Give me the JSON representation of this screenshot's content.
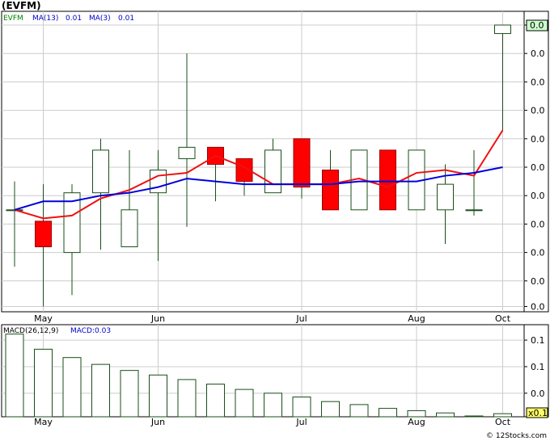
{
  "header": {
    "title": "(EVFM)"
  },
  "footer": {
    "copyright": "© 12Stocks.com"
  },
  "chart_data": [
    {
      "type": "candlestick",
      "legend": [
        "EVFM",
        "MA(13)",
        "0.01",
        "MA(3)",
        "0.01"
      ],
      "legend_colors": [
        "#008000",
        "#0000cc",
        "#0000cc",
        "#0000cc",
        "#0000cc"
      ],
      "ylim": [
        0,
        10
      ],
      "y_tick_values": [
        0.1,
        1.0,
        2.0,
        3.0,
        4.0,
        5.0,
        6.0,
        7.0,
        8.0,
        9.0,
        10.0
      ],
      "y_tick_labels": [
        "0.0",
        "0.0",
        "0.0",
        "0.0",
        "0.0",
        "0.0",
        "0.0",
        "0.0",
        "0.0",
        "0.0",
        "0.0"
      ],
      "last_value_label": "0.0",
      "x_labels": [
        {
          "label": "May",
          "index": 1
        },
        {
          "label": "Jun",
          "index": 5
        },
        {
          "label": "Jul",
          "index": 10
        },
        {
          "label": "Aug",
          "index": 14
        },
        {
          "label": "Oct",
          "index": 17
        }
      ],
      "candles": [
        {
          "o": 3.5,
          "h": 4.5,
          "l": 1.5,
          "c": 3.5
        },
        {
          "o": 3.1,
          "h": 4.4,
          "l": 0.1,
          "c": 2.2
        },
        {
          "o": 2.0,
          "h": 4.4,
          "l": 0.5,
          "c": 4.1
        },
        {
          "o": 4.1,
          "h": 6.0,
          "l": 2.1,
          "c": 5.6
        },
        {
          "o": 2.2,
          "h": 5.6,
          "l": 2.2,
          "c": 3.5
        },
        {
          "o": 4.1,
          "h": 5.6,
          "l": 1.7,
          "c": 4.9
        },
        {
          "o": 5.3,
          "h": 9.0,
          "l": 2.9,
          "c": 5.7
        },
        {
          "o": 5.7,
          "h": 5.7,
          "l": 3.8,
          "c": 5.1
        },
        {
          "o": 5.3,
          "h": 5.3,
          "l": 4.0,
          "c": 4.5
        },
        {
          "o": 4.1,
          "h": 6.0,
          "l": 4.1,
          "c": 5.6
        },
        {
          "o": 6.0,
          "h": 6.0,
          "l": 3.9,
          "c": 4.3
        },
        {
          "o": 4.9,
          "h": 5.6,
          "l": 3.5,
          "c": 3.5
        },
        {
          "o": 3.5,
          "h": 5.6,
          "l": 3.5,
          "c": 5.6
        },
        {
          "o": 5.6,
          "h": 5.6,
          "l": 3.5,
          "c": 3.5
        },
        {
          "o": 3.5,
          "h": 5.6,
          "l": 3.5,
          "c": 5.6
        },
        {
          "o": 3.5,
          "h": 5.1,
          "l": 2.3,
          "c": 4.4
        },
        {
          "o": 3.5,
          "h": 5.6,
          "l": 3.3,
          "c": 3.5
        },
        {
          "o": 9.7,
          "h": 10.0,
          "l": 6.3,
          "c": 10.0
        }
      ],
      "ma13": [
        3.5,
        3.8,
        3.8,
        4.0,
        4.1,
        4.3,
        4.6,
        4.5,
        4.4,
        4.4,
        4.4,
        4.4,
        4.5,
        4.5,
        4.5,
        4.7,
        4.8,
        5.0
      ],
      "ma3": [
        3.5,
        3.2,
        3.3,
        3.9,
        4.2,
        4.7,
        4.8,
        5.4,
        5.0,
        4.4,
        4.4,
        4.4,
        4.6,
        4.3,
        4.8,
        4.9,
        4.7,
        6.3
      ],
      "ma13_color": "#0000dd",
      "ma3_color": "#ee1111",
      "up_color": "#ffffff",
      "down_color": "#ff0000",
      "wick_color": "#1a4d1a"
    },
    {
      "type": "bar",
      "legend": [
        "MACD(26,12,9)",
        "MACD:0.03"
      ],
      "y_tick_labels": [
        "0.1",
        "0.1",
        "0.0"
      ],
      "y_tick_values": [
        0.1,
        0.065,
        0.03
      ],
      "scale_label": "x0.1",
      "values": [
        0.108,
        0.088,
        0.077,
        0.068,
        0.06,
        0.054,
        0.048,
        0.042,
        0.035,
        0.03,
        0.025,
        0.019,
        0.015,
        0.01,
        0.007,
        0.004,
        0.0,
        0.003
      ],
      "ylim": [
        0,
        0.115
      ]
    }
  ]
}
